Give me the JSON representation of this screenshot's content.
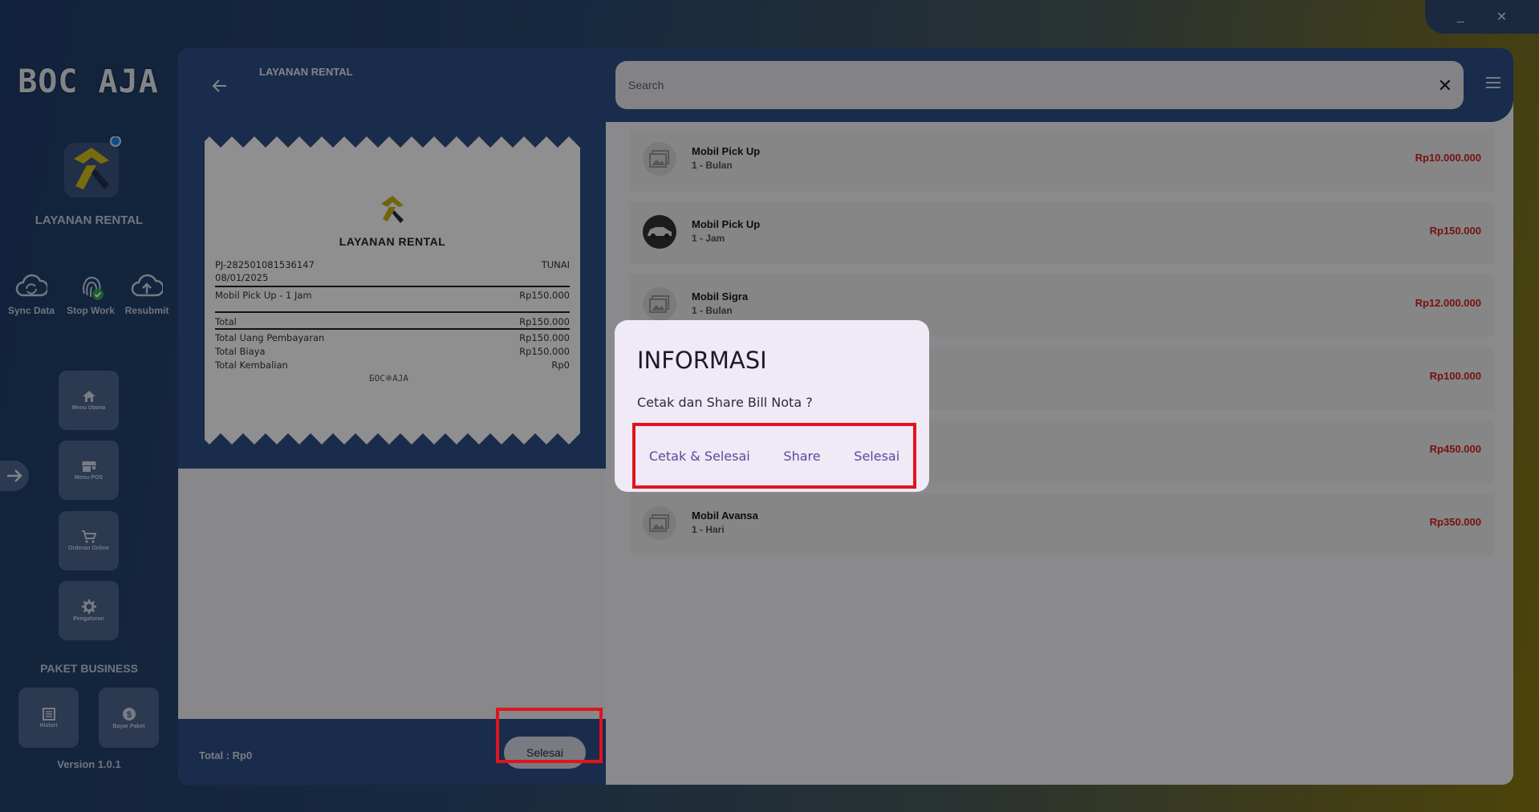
{
  "window": {
    "minimize": "_",
    "close": "✕"
  },
  "sidebar": {
    "logo_text": "BOC AJA",
    "brand_title": "LAYANAN RENTAL",
    "quick_actions": [
      {
        "label": "Sync Data",
        "icon": "cloud-sync-icon"
      },
      {
        "label": "Stop Work",
        "icon": "fingerprint-icon"
      },
      {
        "label": "Resubmit",
        "icon": "cloud-upload-icon"
      }
    ],
    "menu": [
      {
        "label": "Menu Utama",
        "icon": "home-icon"
      },
      {
        "label": "Menu POS",
        "icon": "store-icon"
      },
      {
        "label": "Orderan Online",
        "icon": "cart-icon"
      },
      {
        "label": "Pengaturan",
        "icon": "gear-icon"
      }
    ],
    "package_label": "PAKET BUSINESS",
    "package_buttons": [
      {
        "label": "Histori",
        "icon": "list-icon"
      },
      {
        "label": "Bayar Paket",
        "icon": "dollar-icon"
      }
    ],
    "version": "Version 1.0.1"
  },
  "left_pane": {
    "title": "LAYANAN RENTAL",
    "receipt": {
      "title": "LAYANAN RENTAL",
      "invoice_no": "PJ-282501081536147",
      "payment_method": "TUNAI",
      "date": "08/01/2025",
      "item_label": "Mobil Pick Up - 1 Jam",
      "item_price": "Rp150.000",
      "total_label": "Total",
      "total_value": "Rp150.000",
      "paid_label": "Total Uang Pembayaran",
      "paid_value": "Rp150.000",
      "cost_label": "Total Biaya",
      "cost_value": "Rp150.000",
      "change_label": "Total Kembalian",
      "change_value": "Rp0",
      "signature": "БОС※АJА"
    },
    "footer_total": "Total :  Rp0",
    "finish_button": "Selesai"
  },
  "right_pane": {
    "search_placeholder": "Search",
    "items": [
      {
        "name": "Mobil Pick Up",
        "sub": "1 - Bulan",
        "price": "Rp10.000.000"
      },
      {
        "name": "Mobil Pick Up",
        "sub": "1 - Jam",
        "price": "Rp150.000"
      },
      {
        "name": "Mobil Sigra",
        "sub": "1 - Bulan",
        "price": "Rp12.000.000"
      },
      {
        "name": "",
        "sub": "",
        "price": "Rp100.000"
      },
      {
        "name": "",
        "sub": "",
        "price": "Rp450.000"
      },
      {
        "name": "Mobil Avansa",
        "sub": "1 - Hari",
        "price": "Rp350.000"
      }
    ]
  },
  "dialog": {
    "title": "INFORMASI",
    "message": "Cetak dan Share Bill Nota ?",
    "actions": [
      "Cetak & Selesai",
      "Share",
      "Selesai"
    ]
  },
  "colors": {
    "header": "#2f4f86",
    "price": "#d42020",
    "dialog_bg": "#f0e9f6",
    "dialog_action": "#5a4a99",
    "highlight": "#e0141c",
    "brand_yellow": "#d4c21a"
  }
}
